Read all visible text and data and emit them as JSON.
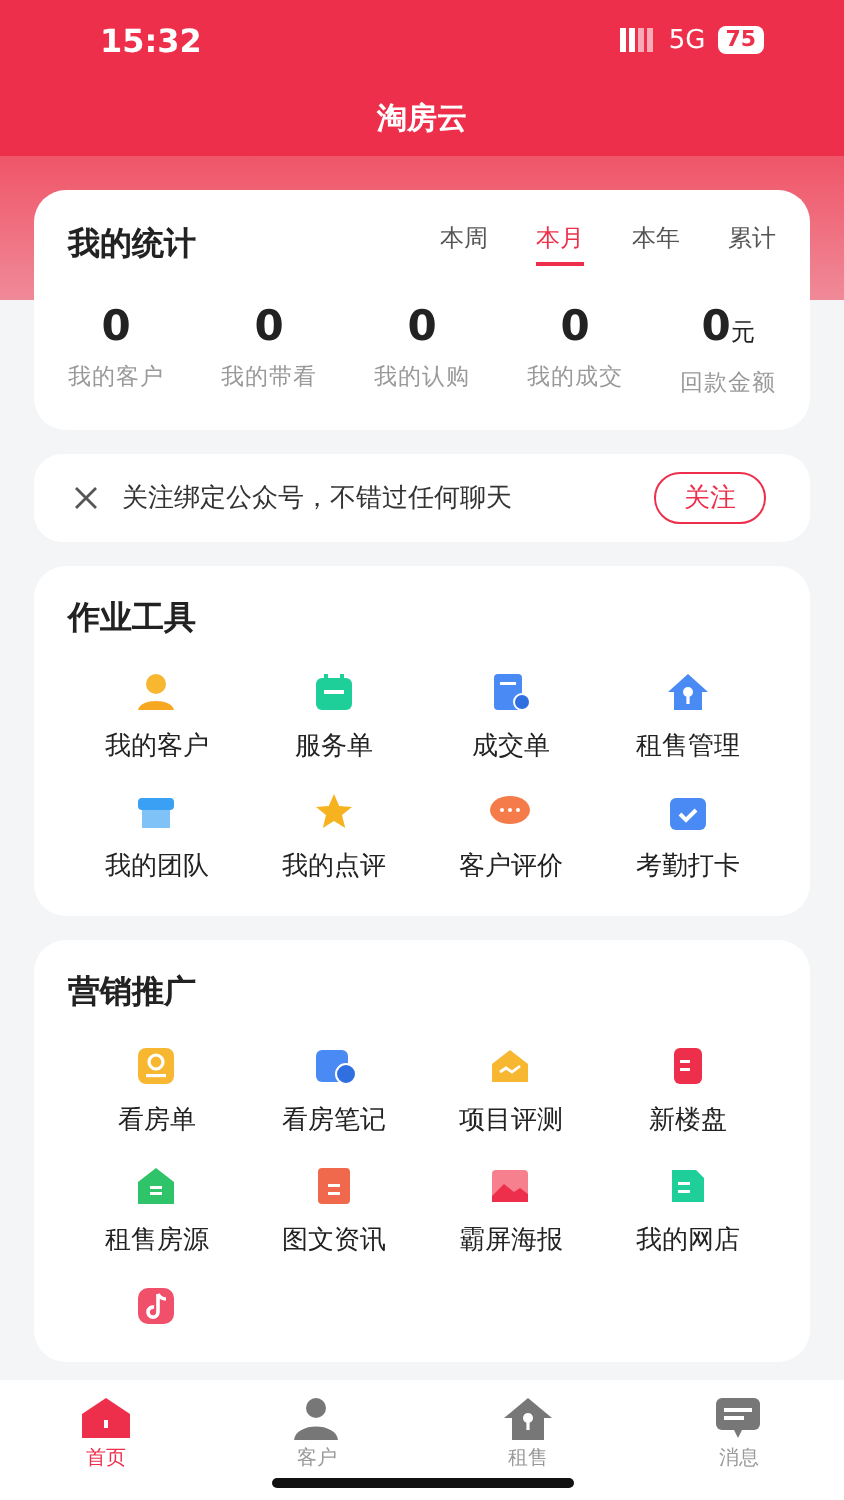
{
  "status_bar": {
    "time": "15:32",
    "network": "5G",
    "battery": "75"
  },
  "header": {
    "title": "淘房云"
  },
  "stats": {
    "title": "我的统计",
    "periods": [
      {
        "label": "本周",
        "selected": false
      },
      {
        "label": "本月",
        "selected": true
      },
      {
        "label": "本年",
        "selected": false
      },
      {
        "label": "累计",
        "selected": false
      }
    ],
    "metrics": [
      {
        "value": "0",
        "label": "我的客户"
      },
      {
        "value": "0",
        "label": "我的带看"
      },
      {
        "value": "0",
        "label": "我的认购"
      },
      {
        "value": "0",
        "label": "我的成交"
      },
      {
        "value": "0",
        "unit": "元",
        "label": "回款金额"
      }
    ]
  },
  "notice": {
    "text": "关注绑定公众号，不错过任何聊天",
    "button": "关注"
  },
  "tools": {
    "title": "作业工具",
    "items": [
      {
        "kind": "labeled",
        "label": "我的客户"
      },
      {
        "kind": "labeled",
        "label": "服务单"
      },
      {
        "kind": "labeled",
        "label": "成交单"
      },
      {
        "kind": "labeled",
        "label": "租售管理"
      },
      {
        "kind": "labeled",
        "label": "我的团队"
      },
      {
        "kind": "labeled",
        "label": "我的点评"
      },
      {
        "kind": "labeled",
        "label": "客户评价"
      },
      {
        "kind": "labeled",
        "label": "考勤打卡"
      }
    ]
  },
  "marketing": {
    "title": "营销推广",
    "items": [
      {
        "kind": "labeled",
        "label": "看房单"
      },
      {
        "kind": "labeled",
        "label": "看房笔记"
      },
      {
        "kind": "labeled",
        "label": "项目评测"
      },
      {
        "kind": "labeled",
        "label": "新楼盘"
      },
      {
        "kind": "labeled",
        "label": "租售房源"
      },
      {
        "kind": "labeled",
        "label": "图文资讯"
      },
      {
        "kind": "labeled",
        "label": "霸屏海报"
      },
      {
        "kind": "labeled",
        "label": "我的网店"
      },
      {
        "kind": "icon-only"
      }
    ]
  },
  "tab_bar": [
    {
      "label": "首页",
      "selected": true
    },
    {
      "label": "客户",
      "selected": false
    },
    {
      "label": "租售",
      "selected": false
    },
    {
      "label": "消息",
      "selected": false
    }
  ]
}
